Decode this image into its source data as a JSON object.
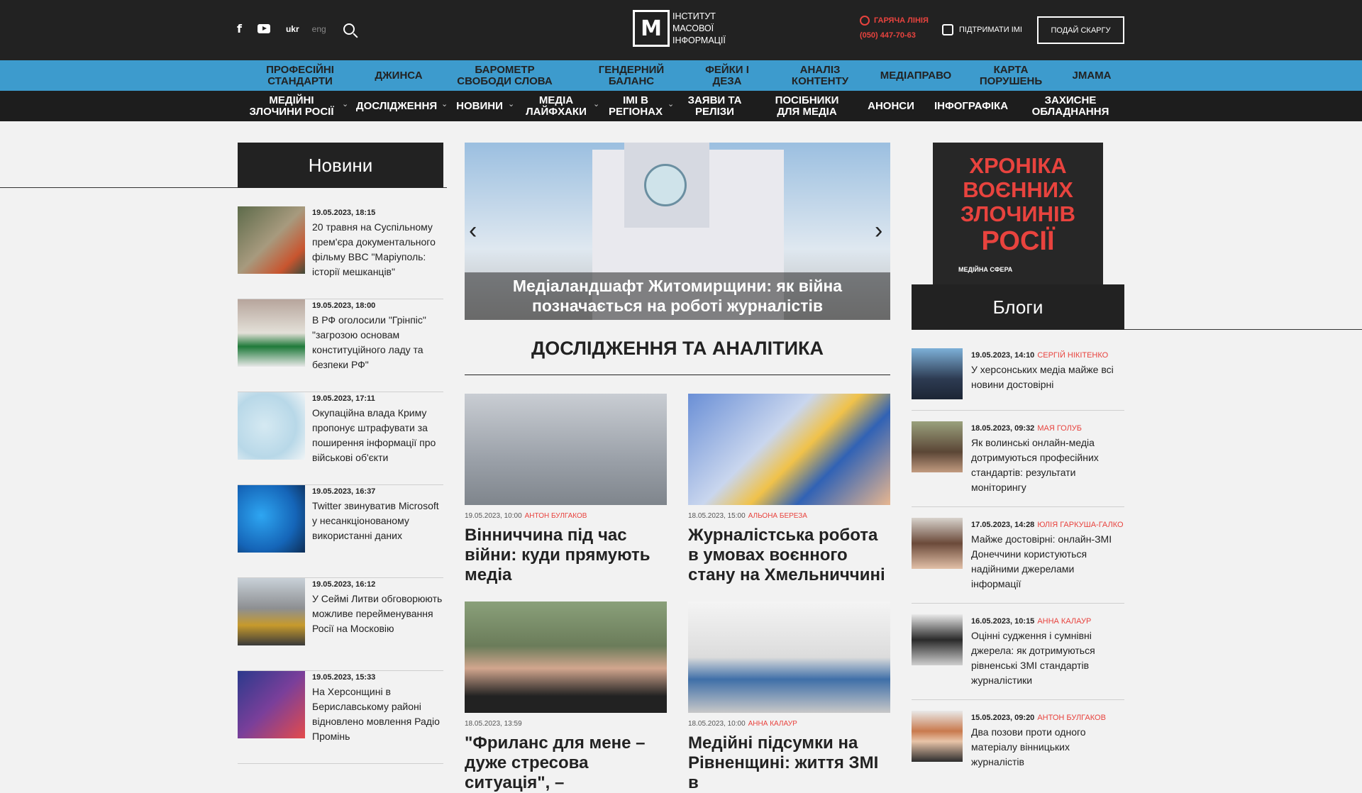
{
  "header": {
    "lang_ukr": "ukr",
    "lang_eng": "eng",
    "logo_letter": "M",
    "logo_lines": [
      "Інститут",
      "масової",
      "інформації"
    ],
    "hotline_label": "ГАРЯЧА ЛІНІЯ",
    "hotline_phone": "(050) 447-70-63",
    "support_label": "ПІДТРИМАТИ ІМІ",
    "complaint_button": "ПОДАЙ СКАРГУ"
  },
  "nav_primary": [
    "ПРОФЕСІЙНІ СТАНДАРТИ",
    "ДЖИНСА",
    "БАРОМЕТР СВОБОДИ СЛОВА",
    "ГЕНДЕРНИЙ БАЛАНС",
    "ФЕЙКИ І ДЕЗА",
    "АНАЛІЗ КОНТЕНТУ",
    "МЕДІАПРАВО",
    "КАРТА ПОРУШЕНЬ",
    "JMAMA"
  ],
  "nav_secondary": [
    "МЕДІЙНІ ЗЛОЧИНИ РОСІЇ",
    "ДОСЛІДЖЕННЯ",
    "НОВИНИ",
    "МЕДІА ЛАЙФХАКИ",
    "ІМІ В РЕГІОНАХ",
    "ЗАЯВИ ТА РЕЛІЗИ",
    "ПОСІБНИКИ ДЛЯ МЕДІА",
    "АНОНСИ",
    "ІНФОГРАФІКА",
    "ЗАХИСНЕ ОБЛАДНАННЯ"
  ],
  "news": {
    "title": "Новини",
    "items": [
      {
        "date": "19.05.2023, 18:15",
        "text": "20 травня на Суспільному прем'єра документального фільму BBC \"Маріуполь: історії мешканців\""
      },
      {
        "date": "19.05.2023, 18:00",
        "text": "В РФ оголосили \"Грінпіс\" \"загрозою основам конституційного ладу та безпеки РФ\""
      },
      {
        "date": "19.05.2023, 17:11",
        "text": "Окупаційна влада Криму пропонує штрафувати за поширення інформації про військові об'єкти"
      },
      {
        "date": "19.05.2023, 16:37",
        "text": "Twitter звинуватив Microsoft у несанкціонованому використанні даних"
      },
      {
        "date": "19.05.2023, 16:12",
        "text": "У Сеймі Литви обговорюють можливе перейменування Росії на Московію"
      },
      {
        "date": "19.05.2023, 15:33",
        "text": "На Херсонщині в Бериславському районі відновлено мовлення Радіо Промінь"
      }
    ]
  },
  "slider": {
    "caption": "Медіаландшафт Житомирщини: як війна позначається на роботі журналістів"
  },
  "research": {
    "title": "ДОСЛІДЖЕННЯ ТА АНАЛІТИКА",
    "cards": [
      {
        "date": "19.05.2023, 10:00",
        "author": "АНТОН БУЛГАКОВ",
        "title": "Вінниччина під час війни: куди прямують медіа"
      },
      {
        "date": "18.05.2023, 15:00",
        "author": "АЛЬОНА БЕРЕЗА",
        "title": "Журналістська робота в умовах воєнного стану на Хмельниччині"
      },
      {
        "date": "18.05.2023, 13:59",
        "author": "",
        "title": "\"Фриланс для мене – дуже стресова ситуація\", –"
      },
      {
        "date": "18.05.2023, 10:00",
        "author": "АННА КАЛАУР",
        "title": "Медійні підсумки на Рівненщині: життя ЗМІ в"
      }
    ]
  },
  "ad": {
    "lines": [
      "ХРОНІКА",
      "ВОЄННИХ",
      "ЗЛОЧИНІВ",
      "РОСІЇ"
    ],
    "sub": "МЕДІЙНА СФЕРА"
  },
  "blogs": {
    "title": "Блоги",
    "items": [
      {
        "date": "19.05.2023, 14:10",
        "author": "СЕРГІЙ НІКІТЕНКО",
        "text": "У херсонських медіа майже всі новини достовірні"
      },
      {
        "date": "18.05.2023, 09:32",
        "author": "МАЯ ГОЛУБ",
        "text": "Як волинські онлайн-медіа дотримуються професійних стандартів: результати моніторингу"
      },
      {
        "date": "17.05.2023, 14:28",
        "author": "ЮЛІЯ ГАРКУША-ГАЛКО",
        "text": "Майже достовірні: онлайн-ЗМІ Донеччини користуються надійними джерелами інформації"
      },
      {
        "date": "16.05.2023, 10:15",
        "author": "АННА КАЛАУР",
        "text": "Оцінні судження і сумнівні джерела: як дотримуються рівненські ЗМІ стандартів журналістики"
      },
      {
        "date": "15.05.2023, 09:20",
        "author": "АНТОН БУЛГАКОВ",
        "text": "Два позови проти одного матеріалу вінницьких журналістів"
      }
    ]
  }
}
